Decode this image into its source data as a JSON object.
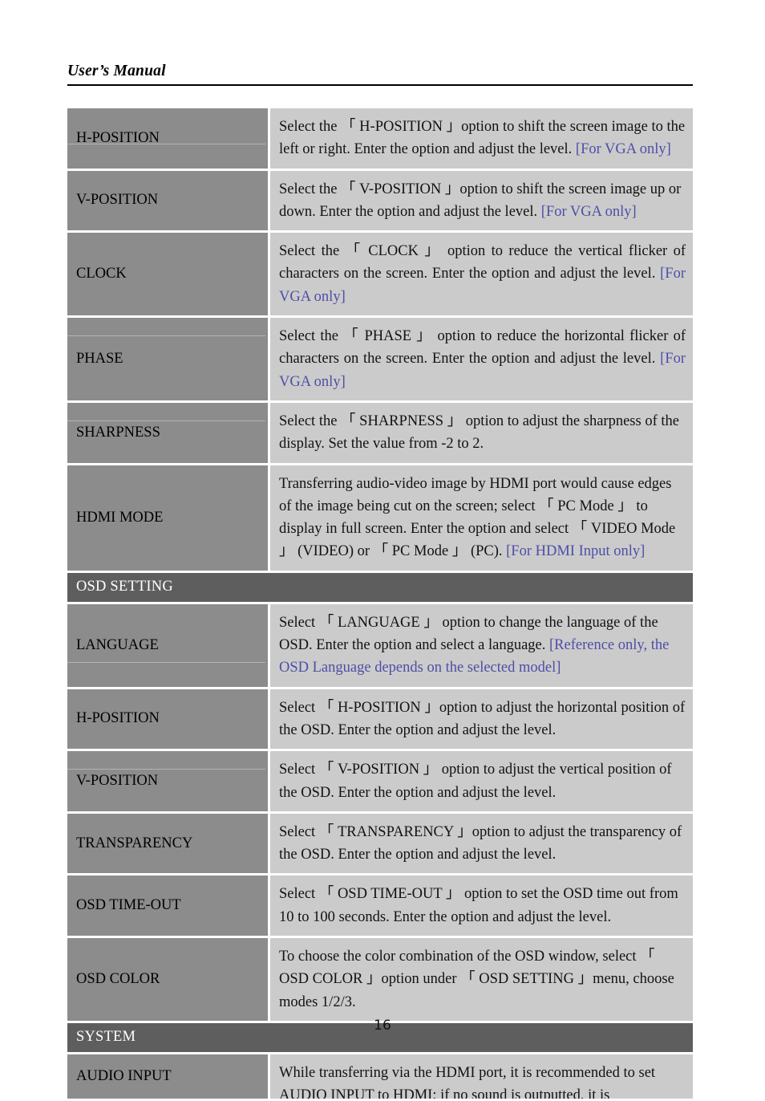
{
  "header": {
    "title": "User’s Manual"
  },
  "footer": {
    "page_number": "16"
  },
  "colors": {
    "label_cell": "#8c8c8c",
    "desc_cell": "#cbcbcb",
    "section_bar": "#5e5e5e",
    "note_blue": "#4e4ea8",
    "text": "#121212",
    "page_background": "#ffffff"
  },
  "table": {
    "rows": [
      {
        "type": "item",
        "label": "H-POSITION",
        "desc_pre": "Select the 「 H-POSITION 」option to shift the screen image to the left or right. Enter the option and adjust the level. ",
        "desc_note": "[For VGA only]"
      },
      {
        "type": "item",
        "label": "V-POSITION",
        "desc_pre": "Select the 「 V-POSITION 」option to shift the screen image up or down. Enter the option and adjust the level. ",
        "desc_note": "[For VGA only]"
      },
      {
        "type": "item",
        "label": "CLOCK",
        "desc_pre": "Select the 「 CLOCK 」 option to reduce the vertical flicker of characters on the screen. Enter the option and adjust the level. ",
        "desc_note": "[For VGA only]"
      },
      {
        "type": "item",
        "label": "PHASE",
        "desc_pre": "Select the 「 PHASE 」 option to reduce the horizontal flicker of characters on the screen. Enter the option and adjust the level. ",
        "desc_note": "[For VGA only]"
      },
      {
        "type": "item",
        "label": "SHARPNESS",
        "desc_pre": "Select the 「 SHARPNESS 」 option to adjust the sharpness of the display. Set the value from -2 to 2.",
        "desc_note": ""
      },
      {
        "type": "item",
        "label": "HDMI MODE",
        "desc_pre": "Transferring audio-video image by HDMI port would cause edges of the image being cut on the screen; select 「 PC Mode 」 to display in full screen. Enter the option and select 「 VIDEO Mode 」 (VIDEO) or 「 PC Mode 」 (PC). ",
        "desc_note": "[For HDMI Input only]"
      },
      {
        "type": "section",
        "label": "OSD SETTING"
      },
      {
        "type": "item",
        "label": "LANGUAGE",
        "desc_pre": "Select 「 LANGUAGE 」 option to change the language of the OSD. Enter the option and select a language. ",
        "desc_note": "[Reference only, the OSD Language depends on the selected model]"
      },
      {
        "type": "item",
        "label": "H-POSITION",
        "desc_pre": "Select 「 H-POSITION 」option to adjust the horizontal position of the OSD. Enter the option and adjust the level.",
        "desc_note": ""
      },
      {
        "type": "item",
        "label": "V-POSITION",
        "desc_pre": "Select 「 V-POSITION 」 option to adjust the vertical position of the OSD. Enter the option and adjust the level.",
        "desc_note": ""
      },
      {
        "type": "item",
        "label": "TRANSPARENCY",
        "desc_pre": "Select 「 TRANSPARENCY 」option to adjust the transparency of the OSD. Enter the option and adjust the level.",
        "desc_note": ""
      },
      {
        "type": "item",
        "label": "OSD TIME-OUT",
        "desc_pre": "Select 「 OSD TIME-OUT 」 option to set the OSD time out from 10 to 100 seconds. Enter the option and adjust the level.",
        "desc_note": ""
      },
      {
        "type": "item",
        "label": "OSD COLOR",
        "desc_pre": "To choose the color combination of the OSD window, select 「 OSD COLOR 」option under 「 OSD SETTING 」menu, choose modes 1/2/3.",
        "desc_note": ""
      },
      {
        "type": "section",
        "label": "SYSTEM"
      },
      {
        "type": "item",
        "label": "AUDIO INPUT",
        "desc_pre": "While transferring via the HDMI port, it is recommended to set AUDIO INPUT to HDMI; if no sound is outputted, it is",
        "desc_note": ""
      }
    ]
  }
}
